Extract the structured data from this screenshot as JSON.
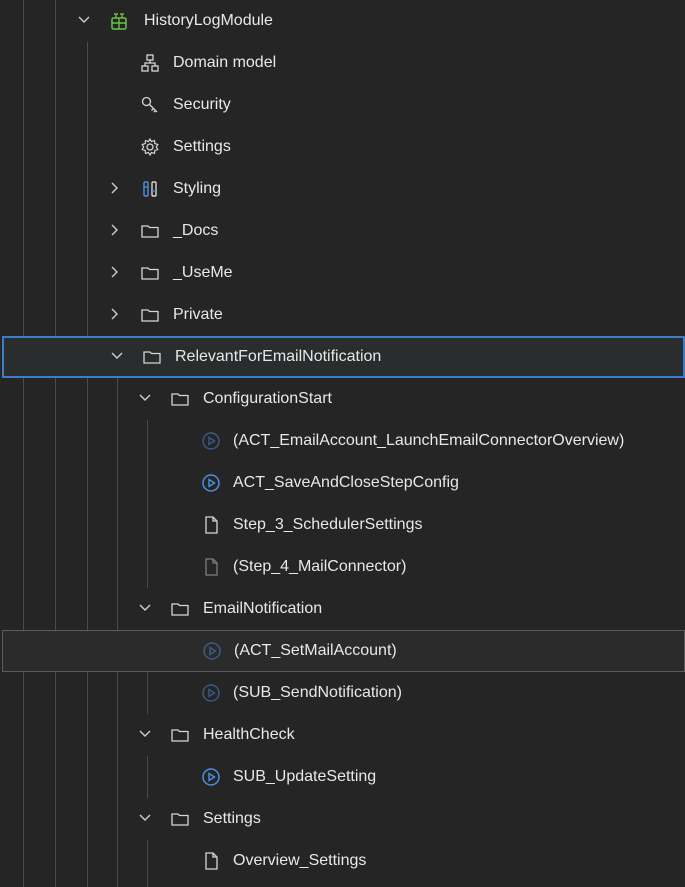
{
  "tree": {
    "module": {
      "label": "HistoryLogModule",
      "icon": "module-icon",
      "expanded": true
    },
    "module_items": [
      {
        "label": "Domain model",
        "icon": "domain-model-icon"
      },
      {
        "label": "Security",
        "icon": "key-icon"
      },
      {
        "label": "Settings",
        "icon": "gear-icon"
      },
      {
        "label": "Styling",
        "icon": "styling-icon",
        "expanded": false
      },
      {
        "label": "_Docs",
        "icon": "folder-icon",
        "expanded": false
      },
      {
        "label": "_UseMe",
        "icon": "folder-icon",
        "expanded": false
      },
      {
        "label": "Private",
        "icon": "folder-icon",
        "expanded": false
      },
      {
        "label": "RelevantForEmailNotification",
        "icon": "folder-icon",
        "expanded": true,
        "selected": true
      }
    ],
    "subfolders": [
      {
        "label": "ConfigurationStart",
        "icon": "folder-icon",
        "expanded": true,
        "items": [
          {
            "label": "(ACT_EmailAccount_LaunchEmailConnectorOverview)",
            "icon": "microflow-icon",
            "excluded": true
          },
          {
            "label": "ACT_SaveAndCloseStepConfig",
            "icon": "microflow-icon",
            "excluded": false
          },
          {
            "label": "Step_3_SchedulerSettings",
            "icon": "page-icon",
            "excluded": false
          },
          {
            "label": "(Step_4_MailConnector)",
            "icon": "page-icon",
            "excluded": true
          }
        ]
      },
      {
        "label": "EmailNotification",
        "icon": "folder-icon",
        "expanded": true,
        "items": [
          {
            "label": "(ACT_SetMailAccount)",
            "icon": "microflow-icon",
            "excluded": true,
            "hovered": true
          },
          {
            "label": "(SUB_SendNotification)",
            "icon": "microflow-icon",
            "excluded": true
          }
        ]
      },
      {
        "label": "HealthCheck",
        "icon": "folder-icon",
        "expanded": true,
        "items": [
          {
            "label": "SUB_UpdateSetting",
            "icon": "microflow-icon",
            "excluded": false
          }
        ]
      },
      {
        "label": "Settings",
        "icon": "folder-icon",
        "expanded": true,
        "items": [
          {
            "label": "Overview_Settings",
            "icon": "page-icon",
            "excluded": false
          }
        ]
      }
    ]
  },
  "colors": {
    "background": "#252526",
    "text": "#e8e8e8",
    "module_icon": "#6cc24a",
    "microflow_icon": "#4a90e2",
    "selection_border": "#3d7cc9"
  }
}
